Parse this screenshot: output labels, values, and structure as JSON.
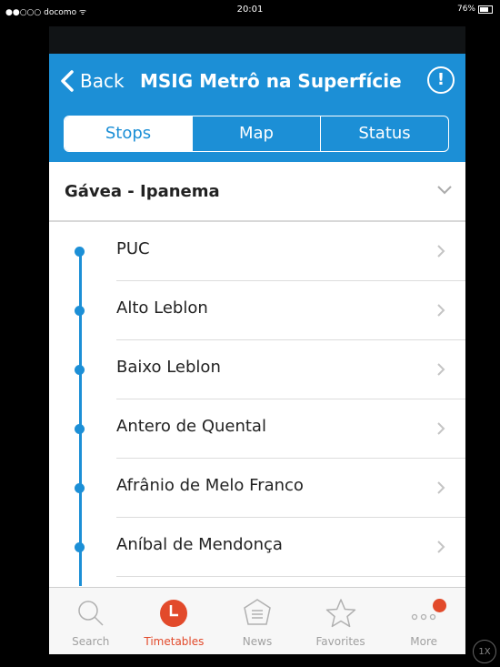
{
  "status_bar": {
    "carrier": "●●○○○ docomo ᯤ",
    "time": "20:01",
    "battery": "76%"
  },
  "header": {
    "back_label": "Back",
    "title": "MSIG Metrô na Superfície",
    "info_label": "!"
  },
  "segments": [
    {
      "label": "Stops",
      "active": true
    },
    {
      "label": "Map",
      "active": false
    },
    {
      "label": "Status",
      "active": false
    }
  ],
  "route": {
    "name": "Gávea - Ipanema"
  },
  "stops": [
    {
      "label": "PUC"
    },
    {
      "label": "Alto Leblon"
    },
    {
      "label": "Baixo Leblon"
    },
    {
      "label": "Antero de Quental"
    },
    {
      "label": "Afrânio de Melo Franco"
    },
    {
      "label": "Aníbal de Mendonça"
    }
  ],
  "tabs": [
    {
      "label": "Search",
      "icon": "search-icon"
    },
    {
      "label": "Timetables",
      "icon": "clock-icon",
      "active": true
    },
    {
      "label": "News",
      "icon": "news-icon"
    },
    {
      "label": "Favorites",
      "icon": "star-icon"
    },
    {
      "label": "More",
      "icon": "more-icon"
    }
  ],
  "zoom": "1X",
  "colors": {
    "accent": "#1c8fd6",
    "active_tab": "#e24a2b"
  }
}
